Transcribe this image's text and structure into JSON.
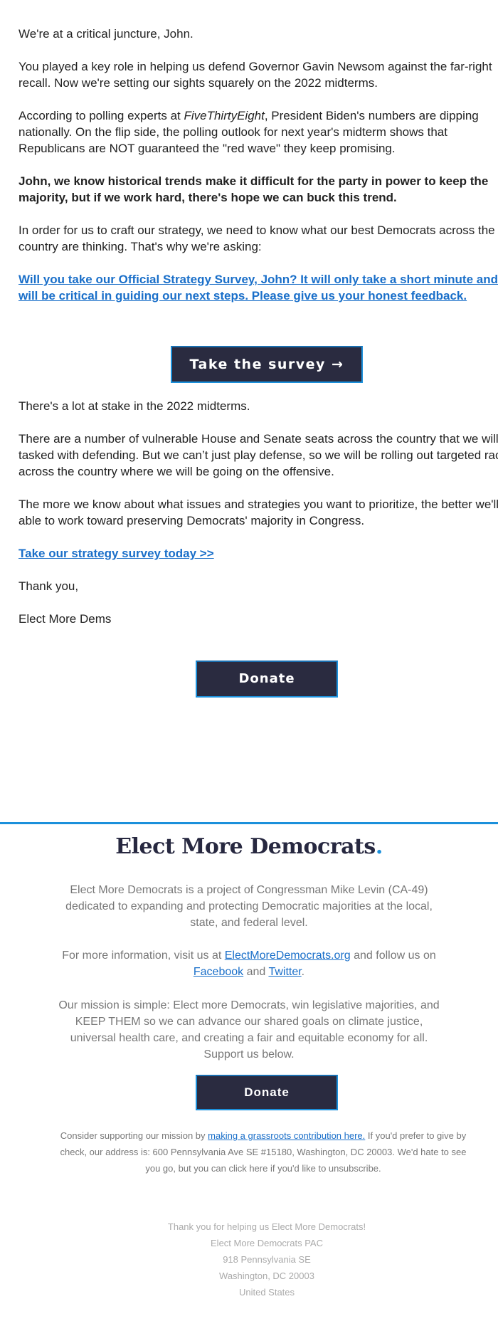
{
  "email": {
    "greeting": "We're at a critical juncture, John.",
    "para1": "You played a key role in helping us defend Governor Gavin Newsom against the far-right recall. Now we're setting our sights squarely on the 2022 midterms.",
    "para2_prefix": "According to polling experts at ",
    "para2_source": "FiveThirtyEight",
    "para2_suffix": ", President Biden's numbers are dipping nationally. On the flip side, the polling outlook for next year's midterm shows that Republicans are NOT guaranteed the \"red wave\" they keep promising.",
    "bold_para": "John, we know historical trends make it difficult for the party in power to keep the majority, but if we work hard, there's hope we can buck this trend.",
    "para3": "In order for us to craft our strategy, we need to know what our best Democrats across the country are thinking. That's why we're asking:",
    "survey_link": "Will you take our Official Strategy Survey, John? It will only take a short minute and will be critical in guiding our next steps. Please give us your honest feedback.",
    "survey_button": "Take the survey →",
    "para4": "There's a lot at stake in the 2022 midterms.",
    "para5": "There are a number of vulnerable House and Senate seats across the country that we will be tasked with defending. But we can’t just play defense, so we will be rolling out targeted races across the country where we will be going on the offensive.",
    "para6": "The more we know about what issues and strategies you want to prioritize, the better we'll be able to work toward preserving Democrats' majority in Congress.",
    "survey_link_2": "Take our strategy survey today >>",
    "closing": "Thank you,",
    "signature": "Elect More Dems",
    "donate_button": "Donate"
  },
  "footer": {
    "brand_name": "Elect More Democrats",
    "brand_dot": ".",
    "about": "Elect More Democrats is a project of Congressman Mike Levin (CA-49) dedicated to expanding and protecting Democratic majorities at the local, state, and federal level.",
    "info_prefix": "For more information, visit us at ",
    "website_link": "ElectMoreDemocrats.org",
    "info_middle": " and follow us on ",
    "facebook_link": "Facebook",
    "info_and": " and ",
    "twitter_link": "Twitter",
    "info_end": ".",
    "mission": "Our mission is simple: Elect more Democrats, win legislative majorities, and KEEP THEM so we can advance our shared goals on climate justice, universal health care, and creating a fair and equitable economy for all. Support us below.",
    "donate_button": "Donate",
    "support_prefix": "Consider supporting our mission by ",
    "support_link": "making a grassroots contribution here.",
    "support_suffix": " If you'd prefer to give by check, our address is: 600 Pennsylvania Ave SE #15180, Washington, DC 20003. We'd hate to see you go, but you can click here if you'd like to unsubscribe.",
    "address_lines": [
      "Thank you for helping us Elect More Democrats!",
      "Elect More Democrats PAC",
      "918 Pennsylvania SE",
      "Washington, DC 20003",
      "United States"
    ]
  },
  "colors": {
    "button_bg": "#2a2b40",
    "accent_blue": "#1b90db",
    "link_blue": "#1a6fc9",
    "body_text": "#222222",
    "footer_text": "#777777",
    "address_text": "#aaaaaa"
  }
}
